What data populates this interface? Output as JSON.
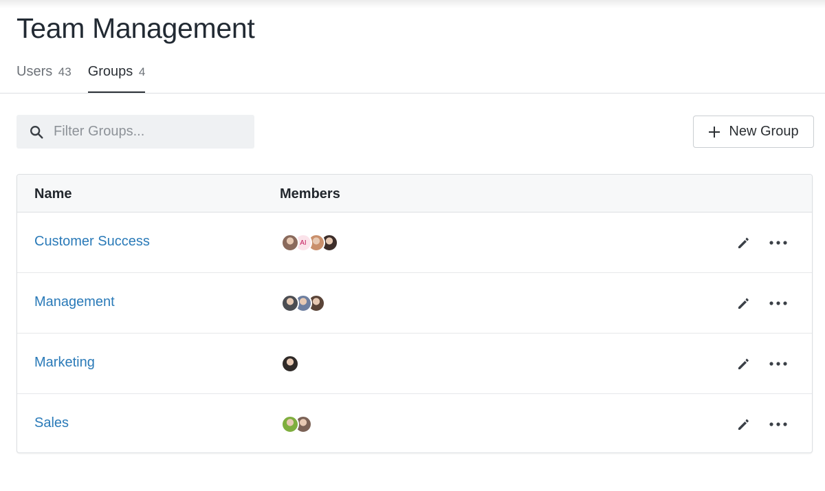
{
  "page": {
    "title": "Team Management"
  },
  "tabs": [
    {
      "label": "Users",
      "count": "43",
      "active": false
    },
    {
      "label": "Groups",
      "count": "4",
      "active": true
    }
  ],
  "search": {
    "placeholder": "Filter Groups...",
    "value": "",
    "icon": "search-icon"
  },
  "toolbar": {
    "new_group_label": "New Group",
    "icon": "plus-icon"
  },
  "table": {
    "columns": {
      "name": "Name",
      "members": "Members"
    },
    "rows": [
      {
        "name": "Customer Success",
        "members": [
          {
            "type": "photo",
            "color": "#8a6a5c"
          },
          {
            "type": "initials",
            "initials": "AI",
            "color": "#fbe3ea"
          },
          {
            "type": "photo",
            "color": "#c98f6b"
          },
          {
            "type": "photo",
            "color": "#3d2e2a"
          }
        ]
      },
      {
        "name": "Management",
        "members": [
          {
            "type": "photo",
            "color": "#4b4d52"
          },
          {
            "type": "photo",
            "color": "#6e7fa0"
          },
          {
            "type": "photo",
            "color": "#5a4438"
          }
        ]
      },
      {
        "name": "Marketing",
        "members": [
          {
            "type": "photo",
            "color": "#2f2a28"
          }
        ]
      },
      {
        "name": "Sales",
        "members": [
          {
            "type": "photo",
            "color": "#7fae3e"
          },
          {
            "type": "photo",
            "color": "#7b6256"
          }
        ]
      }
    ],
    "row_actions": {
      "edit_icon": "pencil-icon",
      "more_icon": "more-horizontal-icon"
    }
  },
  "colors": {
    "link": "#2a7ab8",
    "tab_active": "#2b3036",
    "search_bg": "#eff1f3"
  }
}
